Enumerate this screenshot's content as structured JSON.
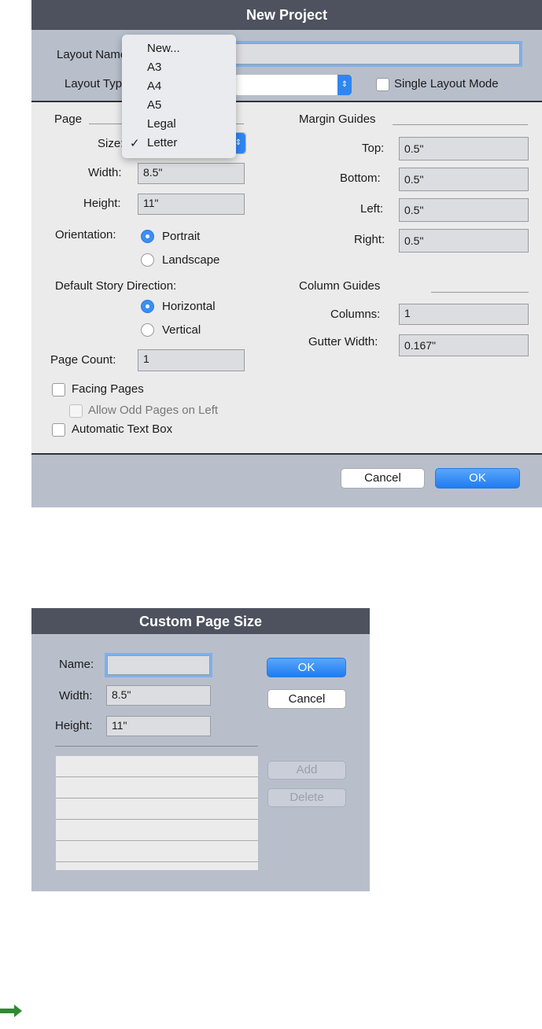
{
  "new_project": {
    "title": "New Project",
    "layout_name_label": "Layout Name:",
    "layout_name_value": "",
    "layout_type_label": "Layout Type:",
    "layout_type_value": "",
    "single_layout_mode": "Single Layout Mode",
    "page": {
      "heading": "Page",
      "size_label": "Size:",
      "width_label": "Width:",
      "width": "8.5\"",
      "height_label": "Height:",
      "height": "11\"",
      "orientation_label": "Orientation:",
      "portrait": "Portrait",
      "landscape": "Landscape",
      "orientation_selected": "Portrait",
      "story_label": "Default Story Direction:",
      "horizontal": "Horizontal",
      "vertical": "Vertical",
      "story_selected": "Horizontal",
      "page_count_label": "Page Count:",
      "page_count": "1",
      "facing_pages": "Facing Pages",
      "allow_odd": "Allow Odd Pages on Left",
      "auto_text_box": "Automatic Text Box"
    },
    "margin": {
      "heading": "Margin Guides",
      "top_label": "Top:",
      "top": "0.5\"",
      "bottom_label": "Bottom:",
      "bottom": "0.5\"",
      "left_label": "Left:",
      "left": "0.5\"",
      "right_label": "Right:",
      "right": "0.5\""
    },
    "column": {
      "heading": "Column Guides",
      "columns_label": "Columns:",
      "columns": "1",
      "gutter_label": "Gutter Width:",
      "gutter": "0.167\""
    },
    "size_menu": {
      "items": [
        "New...",
        "A3",
        "A4",
        "A5",
        "Legal",
        "Letter"
      ],
      "selected": "Letter",
      "check": "✓"
    },
    "cancel": "Cancel",
    "ok": "OK"
  },
  "custom_page_size": {
    "title": "Custom Page Size",
    "name_label": "Name:",
    "name": "",
    "width_label": "Width:",
    "width": "8.5\"",
    "height_label": "Height:",
    "height": "11\"",
    "ok": "OK",
    "cancel": "Cancel",
    "add": "Add",
    "delete": "Delete"
  },
  "colors": {
    "accent": "#1f7cf0",
    "titlebar": "#4d525e",
    "panel": "#b8bfcb",
    "arrow": "#2e8b2e"
  }
}
